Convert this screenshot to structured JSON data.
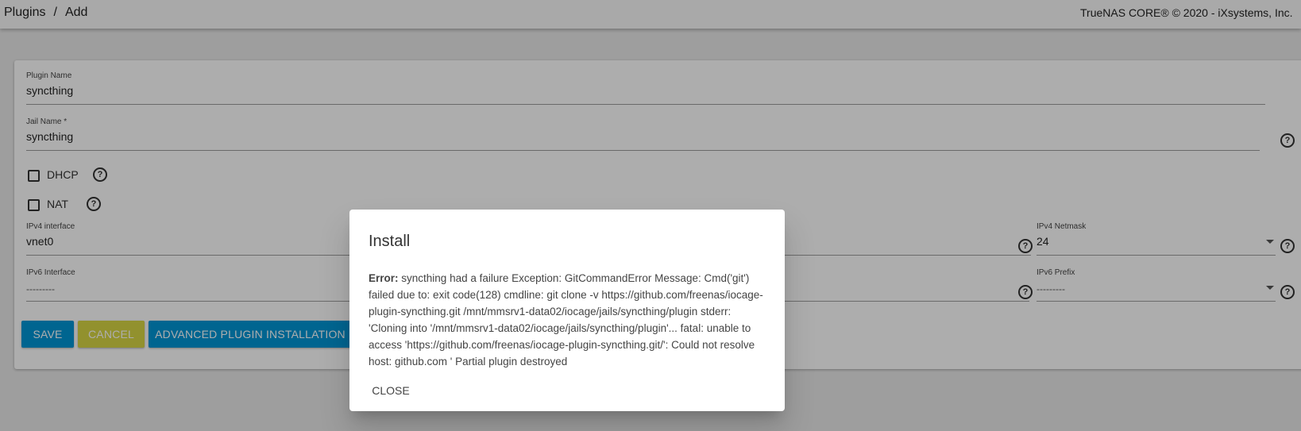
{
  "topbar": {
    "breadcrumb": [
      "Plugins",
      "Add"
    ],
    "brand": "TrueNAS CORE® © 2020 - iXsystems, Inc."
  },
  "form": {
    "plugin_name": {
      "label": "Plugin Name",
      "value": "syncthing"
    },
    "jail_name": {
      "label": "Jail Name *",
      "value": "syncthing"
    },
    "dhcp": {
      "label": "DHCP",
      "checked": false
    },
    "nat": {
      "label": "NAT",
      "checked": false
    },
    "ipv4_interface": {
      "label": "IPv4 interface",
      "value": "vnet0"
    },
    "ipv4_netmask": {
      "label": "IPv4 Netmask",
      "value": "24"
    },
    "ipv6_interface": {
      "label": "IPv6 Interface",
      "value": "---------"
    },
    "ipv6_prefix": {
      "label": "IPv6 Prefix",
      "value": "---------"
    },
    "buttons": {
      "save": "SAVE",
      "cancel": "CANCEL",
      "advanced": "ADVANCED PLUGIN INSTALLATION"
    }
  },
  "dialog": {
    "title": "Install",
    "error_prefix": "Error:",
    "message": "syncthing had a failure Exception: GitCommandError Message: Cmd('git') failed due to: exit code(128) cmdline: git clone -v https://github.com/freenas/iocage-plugin-syncthing.git /mnt/mmsrv1-data02/iocage/jails/syncthing/plugin stderr: 'Cloning into '/mnt/mmsrv1-data02/iocage/jails/syncthing/plugin'... fatal: unable to access 'https://github.com/freenas/iocage-plugin-syncthing.git/': Could not resolve host: github.com ' Partial plugin destroyed",
    "close_label": "CLOSE"
  },
  "icons": {
    "help": "help-circle-icon",
    "caret": "caret-down-icon"
  },
  "colors": {
    "primary": "#0095d5",
    "accent": "#d8d645"
  }
}
